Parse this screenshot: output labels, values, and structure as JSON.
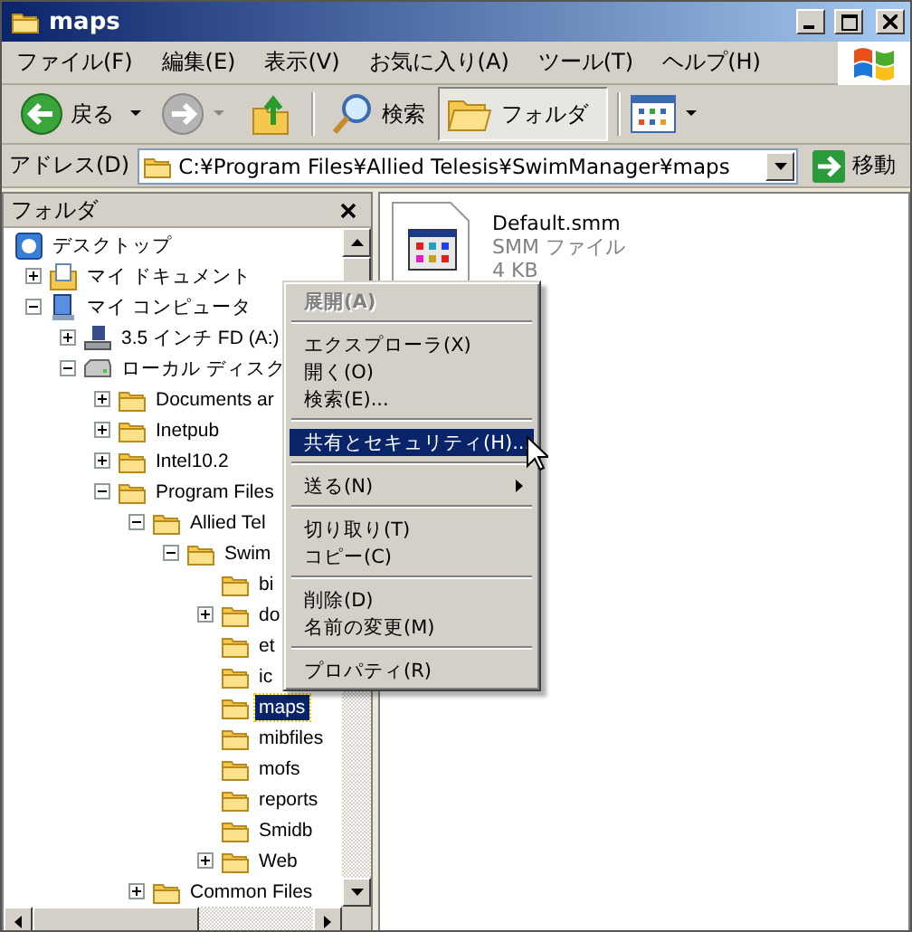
{
  "window": {
    "title": "maps"
  },
  "menu_bar": [
    "ファイル(F)",
    "編集(E)",
    "表示(V)",
    "お気に入り(A)",
    "ツール(T)",
    "ヘルプ(H)"
  ],
  "toolbar": {
    "back": "戻る",
    "search": "検索",
    "folders": {
      "label": "フォルダ",
      "selected": true
    }
  },
  "address_bar": {
    "label": "アドレス(D)",
    "value": "C:¥Program Files¥Allied Telesis¥SwimManager¥maps",
    "go": "移動"
  },
  "folder_pane": {
    "title": "フォルダ",
    "tree": [
      {
        "kind": "desktop",
        "label": "デスクトップ",
        "selected": false,
        "children": [
          {
            "kind": "documents",
            "label": "マイ ドキュメント",
            "selected": false,
            "expanded": false
          },
          {
            "kind": "computer",
            "label": "マイ コンピュータ",
            "selected": false,
            "expanded": true,
            "children": [
              {
                "kind": "floppy",
                "label": "3.5 インチ FD (A:)",
                "selected": false,
                "expanded": false
              },
              {
                "kind": "drive",
                "label": "ローカル ディスク",
                "selected": false,
                "expanded": true,
                "children": [
                  {
                    "kind": "folder",
                    "label": "Documents ar",
                    "selected": false,
                    "expanded": false
                  },
                  {
                    "kind": "folder",
                    "label": "Inetpub",
                    "selected": false,
                    "expanded": false
                  },
                  {
                    "kind": "folder",
                    "label": "Intel10.2",
                    "selected": false,
                    "expanded": false
                  },
                  {
                    "kind": "folder",
                    "label": "Program Files",
                    "selected": false,
                    "expanded": true,
                    "children": [
                      {
                        "kind": "folder",
                        "label": "Allied Tel",
                        "selected": false,
                        "expanded": true,
                        "children": [
                          {
                            "kind": "folder",
                            "label": "Swim",
                            "selected": false,
                            "expanded": true,
                            "children": [
                              {
                                "kind": "folder",
                                "label": "bi",
                                "selected": false
                              },
                              {
                                "kind": "folder",
                                "label": "do",
                                "selected": false,
                                "expanded": false
                              },
                              {
                                "kind": "folder",
                                "label": "et",
                                "selected": false
                              },
                              {
                                "kind": "folder",
                                "label": "ic",
                                "selected": false
                              },
                              {
                                "kind": "folder",
                                "label": "maps",
                                "selected": true
                              },
                              {
                                "kind": "folder",
                                "label": "mibfiles",
                                "selected": false
                              },
                              {
                                "kind": "folder",
                                "label": "mofs",
                                "selected": false
                              },
                              {
                                "kind": "folder",
                                "label": "reports",
                                "selected": false
                              },
                              {
                                "kind": "folder",
                                "label": "Smidb",
                                "selected": false
                              },
                              {
                                "kind": "folder",
                                "label": "Web",
                                "selected": false,
                                "expanded": false
                              }
                            ]
                          }
                        ]
                      },
                      {
                        "kind": "folder",
                        "label": "Common Files",
                        "selected": false,
                        "expanded": false
                      }
                    ]
                  }
                ]
              }
            ]
          }
        ]
      }
    ]
  },
  "files": [
    {
      "name": "Default.smm",
      "type": "SMM ファイル",
      "size": "4 KB"
    }
  ],
  "context_menu": [
    {
      "kind": "item",
      "label": "展開(A)",
      "default": true,
      "disabled": true,
      "selected": false,
      "submenu": false
    },
    {
      "kind": "separator"
    },
    {
      "kind": "item",
      "label": "エクスプローラ(X)",
      "default": false,
      "disabled": false,
      "selected": false,
      "submenu": false
    },
    {
      "kind": "item",
      "label": "開く(O)",
      "default": false,
      "disabled": false,
      "selected": false,
      "submenu": false
    },
    {
      "kind": "item",
      "label": "検索(E)...",
      "default": false,
      "disabled": false,
      "selected": false,
      "submenu": false
    },
    {
      "kind": "separator"
    },
    {
      "kind": "item",
      "label": "共有とセキュリティ(H)...",
      "default": false,
      "disabled": false,
      "selected": true,
      "submenu": false
    },
    {
      "kind": "separator"
    },
    {
      "kind": "item",
      "label": "送る(N)",
      "default": false,
      "disabled": false,
      "selected": false,
      "submenu": true
    },
    {
      "kind": "separator"
    },
    {
      "kind": "item",
      "label": "切り取り(T)",
      "default": false,
      "disabled": false,
      "selected": false,
      "submenu": false
    },
    {
      "kind": "item",
      "label": "コピー(C)",
      "default": false,
      "disabled": false,
      "selected": false,
      "submenu": false
    },
    {
      "kind": "separator"
    },
    {
      "kind": "item",
      "label": "削除(D)",
      "default": false,
      "disabled": false,
      "selected": false,
      "submenu": false
    },
    {
      "kind": "item",
      "label": "名前の変更(M)",
      "default": false,
      "disabled": false,
      "selected": false,
      "submenu": false
    },
    {
      "kind": "separator"
    },
    {
      "kind": "item",
      "label": "プロパティ(R)",
      "default": false,
      "disabled": false,
      "selected": false,
      "submenu": false
    }
  ]
}
